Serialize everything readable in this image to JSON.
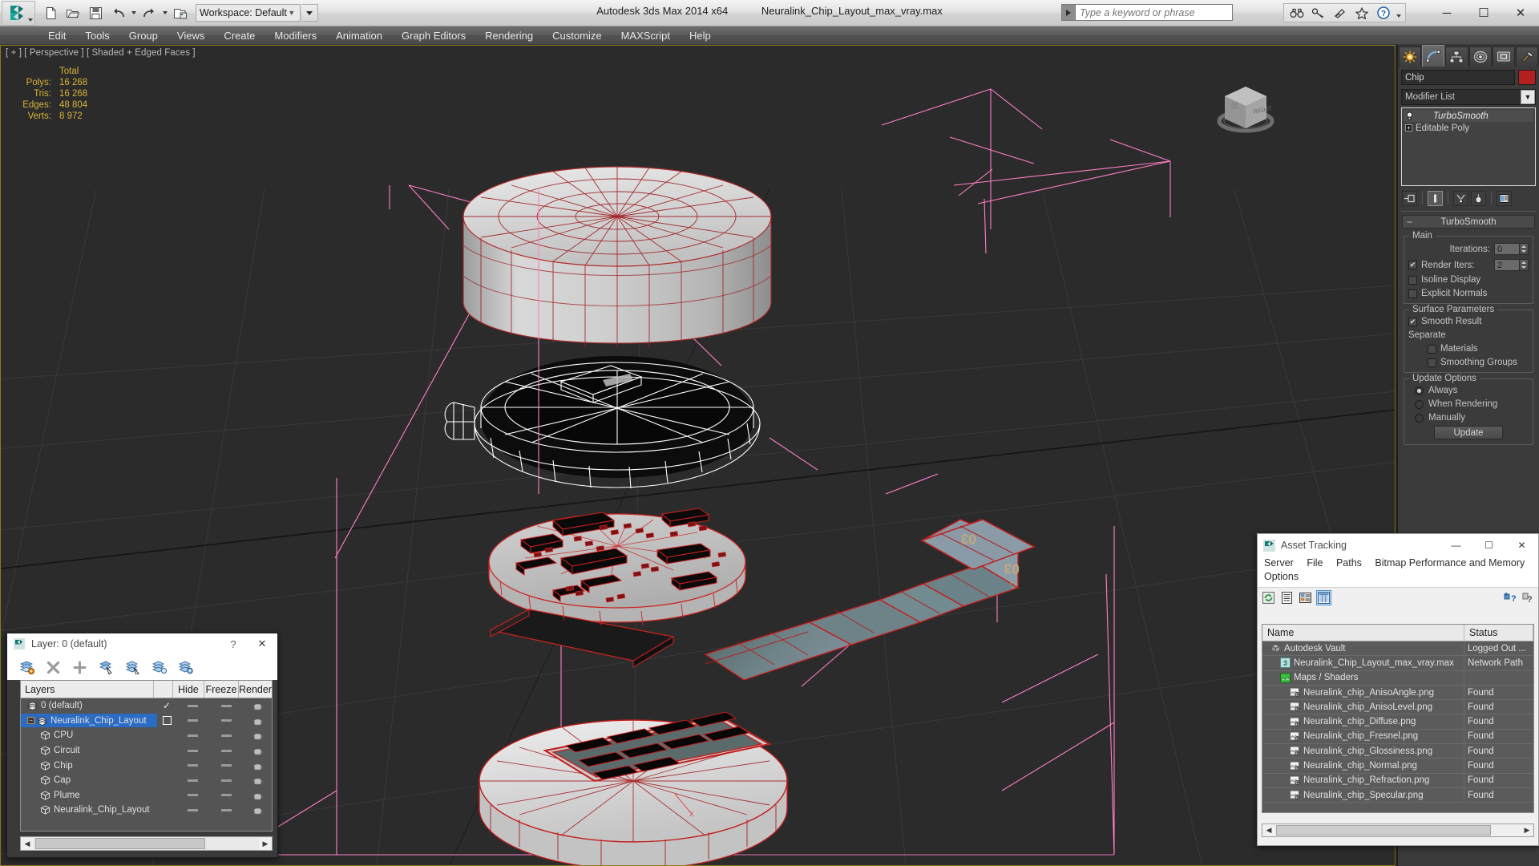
{
  "titlebar": {
    "app_title": "Autodesk 3ds Max  2014 x64",
    "file_title": "Neuralink_Chip_Layout_max_vray.max",
    "workspace": "Workspace: Default",
    "quick_access": [
      {
        "name": "new-file-icon",
        "label": "New"
      },
      {
        "name": "open-file-icon",
        "label": "Open"
      },
      {
        "name": "save-file-icon",
        "label": "Save"
      },
      {
        "name": "undo-icon",
        "label": "Undo"
      },
      {
        "name": "redo-icon",
        "label": "Redo"
      },
      {
        "name": "project-folder-icon",
        "label": "Set Project Folder"
      }
    ],
    "search_placeholder": "Type a keyword or phrase",
    "help_icons": [
      "binoculars-icon",
      "key-icon",
      "satellite-icon",
      "star-icon",
      "help-question-icon"
    ],
    "window_controls": {
      "minimize": "─",
      "maximize": "☐",
      "close": "✕"
    }
  },
  "menubar": {
    "items": [
      "Edit",
      "Tools",
      "Group",
      "Views",
      "Create",
      "Modifiers",
      "Animation",
      "Graph Editors",
      "Rendering",
      "Customize",
      "MAXScript",
      "Help"
    ]
  },
  "viewport": {
    "label": "[ + ] [ Perspective ] [ Shaded + Edged Faces ]",
    "stats": {
      "header": "Total",
      "rows": [
        {
          "label": "Polys:",
          "value": "16 268"
        },
        {
          "label": "Tris:",
          "value": "16 268"
        },
        {
          "label": "Edges:",
          "value": "48 804"
        },
        {
          "label": "Verts:",
          "value": "8 972"
        }
      ]
    },
    "viewcube_face": "RIGHT",
    "scene_notes": {
      "flex_cable_text": "03",
      "selection_color": "#cc1111",
      "helper_color": "#ff7fc0"
    }
  },
  "command_panel": {
    "tabs": [
      {
        "name": "create-tab",
        "label": "Create",
        "active": false
      },
      {
        "name": "modify-tab",
        "label": "Modify",
        "active": true
      },
      {
        "name": "hierarchy-tab",
        "label": "Hierarchy",
        "active": false
      },
      {
        "name": "motion-tab",
        "label": "Motion",
        "active": false
      },
      {
        "name": "display-tab",
        "label": "Display",
        "active": false
      },
      {
        "name": "utilities-tab",
        "label": "Utilities",
        "active": false
      }
    ],
    "object_name": "Chip",
    "object_color": "#b42020",
    "modifier_list_label": "Modifier List",
    "stack": [
      {
        "label": "TurboSmooth",
        "selected": true
      },
      {
        "label": "Editable Poly",
        "selected": false
      }
    ],
    "turbosmooth": {
      "rollout_title": "TurboSmooth",
      "main_group": "Main",
      "iterations_label": "Iterations:",
      "iterations_value": "0",
      "render_iters_label": "Render Iters:",
      "render_iters_value": "2",
      "render_iters_checked": true,
      "isoline_display_label": "Isoline Display",
      "isoline_display_checked": false,
      "explicit_normals_label": "Explicit Normals",
      "explicit_normals_checked": false,
      "surface_params_group": "Surface Parameters",
      "smooth_result_label": "Smooth Result",
      "smooth_result_checked": true,
      "separate_label": "Separate",
      "materials_label": "Materials",
      "materials_checked": false,
      "smoothing_groups_label": "Smoothing Groups",
      "smoothing_groups_checked": false,
      "update_options_group": "Update Options",
      "update_modes": [
        {
          "label": "Always",
          "selected": true
        },
        {
          "label": "When Rendering",
          "selected": false
        },
        {
          "label": "Manually",
          "selected": false
        }
      ],
      "update_button": "Update"
    }
  },
  "asset_tracking": {
    "window_title": "Asset Tracking",
    "menu": [
      "Server",
      "File",
      "Paths",
      "Bitmap Performance and Memory",
      "Options"
    ],
    "toolbar_icons": [
      "refresh-icon",
      "list-view-icon",
      "detail-view-icon",
      "grid-view-icon",
      "add-help-icon",
      "help-icon"
    ],
    "columns": [
      "Name",
      "Status"
    ],
    "rows": [
      {
        "name": "Autodesk Vault",
        "status": "Logged Out ...",
        "indent": 0,
        "icon": "vault-icon"
      },
      {
        "name": "Neuralink_Chip_Layout_max_vray.max",
        "status": "Network Path",
        "indent": 1,
        "icon": "max-file-icon"
      },
      {
        "name": "Maps / Shaders",
        "status": "",
        "indent": 1,
        "icon": "maps-icon"
      },
      {
        "name": "Neuralink_chip_AnisoAngle.png",
        "status": "Found",
        "indent": 2,
        "icon": "bitmap-icon"
      },
      {
        "name": "Neuralink_chip_AnisoLevel.png",
        "status": "Found",
        "indent": 2,
        "icon": "bitmap-icon"
      },
      {
        "name": "Neuralink_chip_Diffuse.png",
        "status": "Found",
        "indent": 2,
        "icon": "bitmap-icon"
      },
      {
        "name": "Neuralink_chip_Fresnel.png",
        "status": "Found",
        "indent": 2,
        "icon": "bitmap-icon"
      },
      {
        "name": "Neuralink_chip_Glossiness.png",
        "status": "Found",
        "indent": 2,
        "icon": "bitmap-icon"
      },
      {
        "name": "Neuralink_chip_Normal.png",
        "status": "Found",
        "indent": 2,
        "icon": "bitmap-icon"
      },
      {
        "name": "Neuralink_chip_Refraction.png",
        "status": "Found",
        "indent": 2,
        "icon": "bitmap-icon"
      },
      {
        "name": "Neuralink_chip_Specular.png",
        "status": "Found",
        "indent": 2,
        "icon": "bitmap-icon"
      }
    ]
  },
  "layer_dialog": {
    "window_title": "Layer: 0 (default)",
    "help_glyph": "?",
    "close_glyph": "✕",
    "toolbar_icons": [
      "create-new-layer-icon",
      "delete-layer-icon",
      "add-selection-icon",
      "select-objects-icon",
      "select-highlighted-icon",
      "highlight-selected-icon",
      "layer-properties-icon"
    ],
    "columns": [
      "Layers",
      "",
      "Hide",
      "Freeze",
      "Render"
    ],
    "rows": [
      {
        "name": "0 (default)",
        "type": "layer",
        "indent": 0,
        "current": true,
        "selected": false,
        "expander": false
      },
      {
        "name": "Neuralink_Chip_Layout",
        "type": "layer",
        "indent": 0,
        "current": false,
        "selected": true,
        "expander": true
      },
      {
        "name": "CPU",
        "type": "object",
        "indent": 1,
        "current": false,
        "selected": false,
        "expander": false
      },
      {
        "name": "Circuit",
        "type": "object",
        "indent": 1,
        "current": false,
        "selected": false,
        "expander": false
      },
      {
        "name": "Chip",
        "type": "object",
        "indent": 1,
        "current": false,
        "selected": false,
        "expander": false
      },
      {
        "name": "Cap",
        "type": "object",
        "indent": 1,
        "current": false,
        "selected": false,
        "expander": false
      },
      {
        "name": "Plume",
        "type": "object",
        "indent": 1,
        "current": false,
        "selected": false,
        "expander": false
      },
      {
        "name": "Neuralink_Chip_Layout",
        "type": "object",
        "indent": 1,
        "current": false,
        "selected": false,
        "expander": false
      }
    ]
  }
}
